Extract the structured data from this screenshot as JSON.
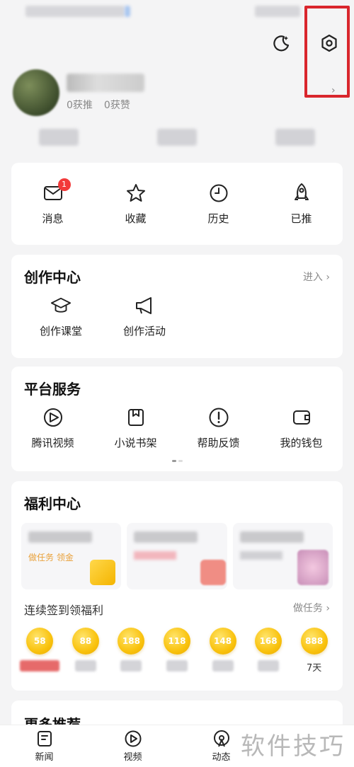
{
  "counts": {
    "tui": "0获推",
    "zan": "0获赞"
  },
  "quick": [
    {
      "label": "消息",
      "badge": "1"
    },
    {
      "label": "收藏"
    },
    {
      "label": "历史"
    },
    {
      "label": "已推"
    }
  ],
  "creator": {
    "title": "创作中心",
    "link": "进入 ›",
    "items": [
      {
        "label": "创作课堂"
      },
      {
        "label": "创作活动"
      }
    ]
  },
  "service": {
    "title": "平台服务",
    "items": [
      {
        "label": "腾讯视频"
      },
      {
        "label": "小说书架"
      },
      {
        "label": "帮助反馈"
      },
      {
        "label": "我的钱包"
      }
    ]
  },
  "welfare": {
    "title": "福利中心",
    "banner_text": "做任务 领金",
    "signin_title": "连续签到领福利",
    "signin_link": "做任务 ›",
    "coins": [
      "58",
      "88",
      "188",
      "118",
      "148",
      "168",
      "888"
    ],
    "last_day": "7天"
  },
  "more": {
    "title": "更多推荐"
  },
  "tabs": [
    {
      "label": "新闻"
    },
    {
      "label": "视频"
    },
    {
      "label": "动态"
    }
  ],
  "watermark": "软件技巧",
  "colors": {
    "accent_red": "#d9262d",
    "coin_gold": "#f9c20d",
    "badge_red": "#f23a3a"
  }
}
